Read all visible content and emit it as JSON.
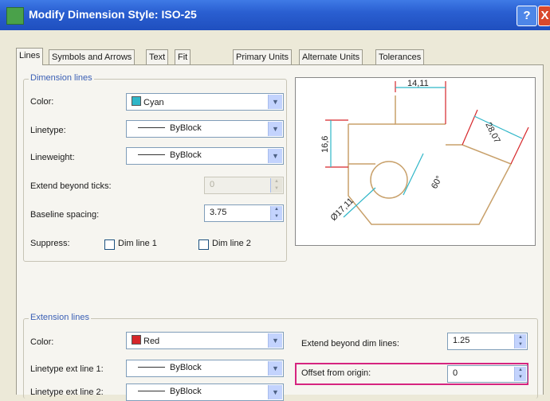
{
  "window": {
    "title": "Modify Dimension Style: ISO-25",
    "help_label": "?",
    "close_label": "X"
  },
  "tabs": [
    "Lines",
    "Symbols and Arrows",
    "Text",
    "Fit",
    "Primary Units",
    "Alternate Units",
    "Tolerances"
  ],
  "dimension_lines": {
    "group_title": "Dimension lines",
    "color_label": "Color:",
    "color_value": "Cyan",
    "color_hex": "#2fb6c8",
    "linetype_label": "Linetype:",
    "linetype_value": "ByBlock",
    "lineweight_label": "Lineweight:",
    "lineweight_value": "ByBlock",
    "extend_label": "Extend beyond ticks:",
    "extend_value": "0",
    "baseline_label": "Baseline spacing:",
    "baseline_value": "3.75",
    "suppress_label": "Suppress:",
    "dim_line1_label": "Dim line 1",
    "dim_line2_label": "Dim line 2"
  },
  "extension_lines": {
    "group_title": "Extension lines",
    "color_label": "Color:",
    "color_value": "Red",
    "color_hex": "#d6262a",
    "linetype1_label": "Linetype ext line 1:",
    "linetype1_value": "ByBlock",
    "linetype2_label": "Linetype ext line 2:",
    "linetype2_value": "ByBlock",
    "extend_label": "Extend beyond dim lines:",
    "extend_value": "1.25",
    "offset_label": "Offset from origin:",
    "offset_value": "0"
  },
  "preview": {
    "dim_top": "14,11",
    "dim_left": "16,6",
    "dim_right": "28,07",
    "dim_dia": "Ø17,11",
    "dim_angle": "60°",
    "object_color": "#c8a06a",
    "dim_color": "#2fb6c8",
    "ext_color": "#d6262a"
  },
  "highlight_color": "#d6247f"
}
